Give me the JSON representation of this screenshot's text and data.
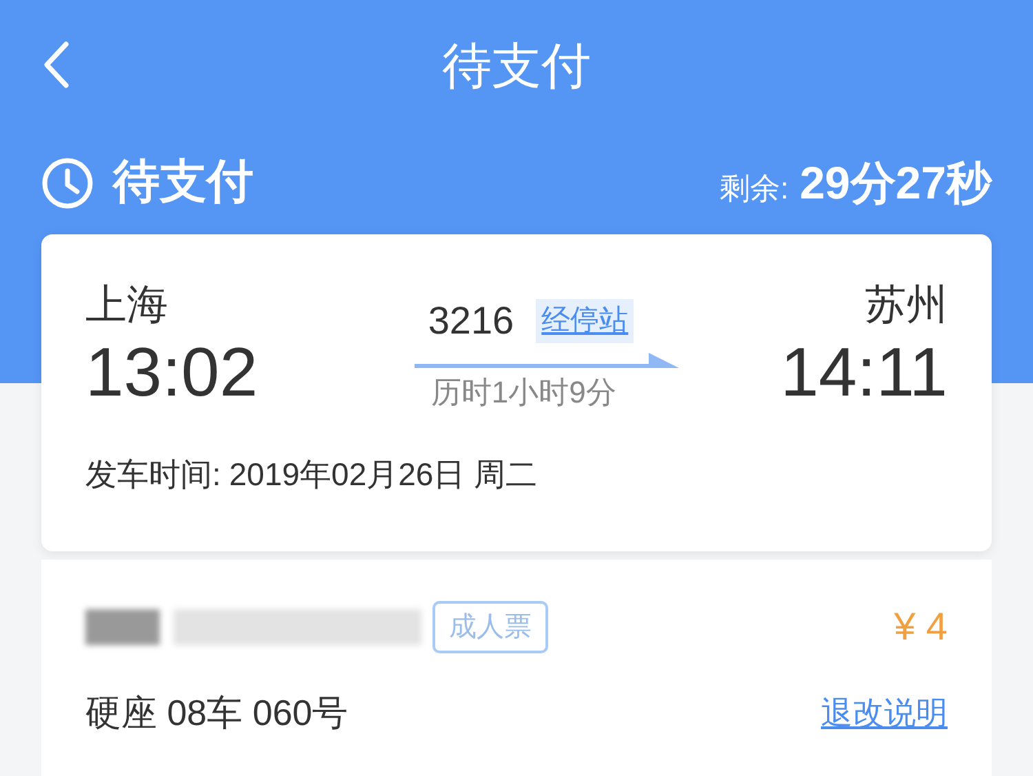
{
  "nav": {
    "title": "待支付"
  },
  "status": {
    "label": "待支付",
    "remaining_label": "剩余:",
    "remaining": "29分27秒"
  },
  "trip": {
    "from": "上海",
    "depart": "13:02",
    "train": "3216",
    "stops_link": "经停站",
    "duration": "历时1小时9分",
    "to": "苏州",
    "arrive": "14:11",
    "date_label": "发车时间:",
    "date": "2019年02月26日 周二"
  },
  "passenger": {
    "ticket_type": "成人票",
    "price": "¥ 4",
    "seat": "硬座 08车 060号",
    "refund_link": "退改说明"
  }
}
